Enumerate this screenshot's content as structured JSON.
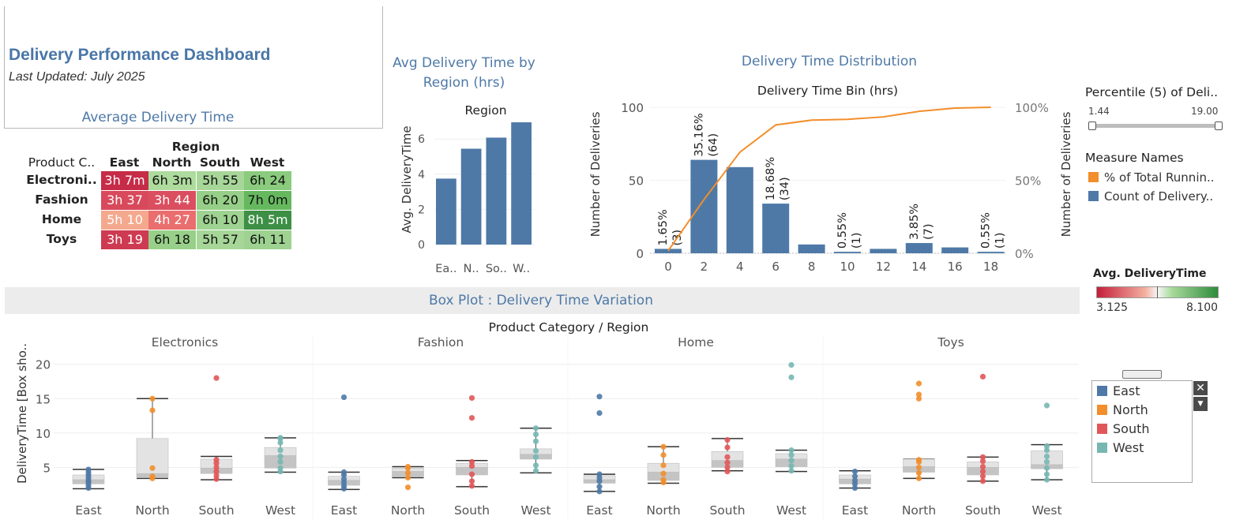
{
  "header": {
    "title": "Delivery Performance Dashboard",
    "subtitle": "Last Updated: July 2025"
  },
  "heatmap": {
    "title": "Average Delivery Time",
    "region_header": "Region",
    "row_header": "Product C..",
    "columns": [
      "East",
      "North",
      "South",
      "West"
    ],
    "rows": [
      {
        "label": "Electroni..",
        "values": [
          "3h 7m",
          "6h 3m",
          "5h 55",
          "6h 24"
        ],
        "colors": [
          "#c62c48",
          "#aedb9e",
          "#a7d699",
          "#8acb7d"
        ]
      },
      {
        "label": "Fashion",
        "values": [
          "3h 37",
          "3h 44",
          "6h 20",
          "7h 0m"
        ],
        "colors": [
          "#d9495c",
          "#da4e5f",
          "#96cf87",
          "#66b85f"
        ]
      },
      {
        "label": "Home",
        "values": [
          "5h 10",
          "4h 27",
          "6h 10",
          "8h 5m"
        ],
        "colors": [
          "#f4a98e",
          "#ea6e6e",
          "#9fd392",
          "#3d8f46"
        ]
      },
      {
        "label": "Toys",
        "values": [
          "3h 19",
          "6h 18",
          "5h 57",
          "6h 11"
        ],
        "colors": [
          "#ce3a52",
          "#98d089",
          "#a6d698",
          "#9dd291"
        ]
      }
    ]
  },
  "bar_title": "Avg Delivery Time by Region (hrs)",
  "dist_title": "Delivery Time Distribution",
  "box_title": "Box Plot : Delivery Time Variation",
  "chart_data": [
    {
      "type": "bar",
      "title": "Region",
      "ylabel": "Avg. DeliveryTime",
      "categories": [
        "Ea..",
        "N..",
        "So..",
        "W.."
      ],
      "values": [
        3.75,
        5.45,
        6.08,
        6.95
      ],
      "ylim": [
        0,
        7.4
      ],
      "yticks": [
        0,
        2,
        4,
        6
      ],
      "color": "#4e79a7"
    },
    {
      "type": "bar",
      "title": "Delivery Time Bin (hrs)",
      "ylabel": "Number of Deliveries",
      "ylabel_right": "Number of Deliveries",
      "x": [
        0,
        2,
        4,
        6,
        8,
        10,
        12,
        14,
        16,
        18
      ],
      "values": [
        3,
        64,
        59,
        34,
        6,
        1,
        3,
        7,
        4,
        1
      ],
      "labels": [
        "1.65%\n(3)",
        "35.16%\n(64)",
        "",
        "18.68%\n(34)",
        "",
        "0.55%\n(1)",
        "",
        "3.85%\n(7)",
        "",
        "0.55%\n(1)"
      ],
      "ylim": [
        0,
        100
      ],
      "yticks": [
        0,
        50,
        100
      ],
      "y2ticks": [
        "0%",
        "50%",
        "100%"
      ],
      "series": [
        {
          "name": "Count of Delivery..",
          "values": [
            3,
            64,
            59,
            34,
            6,
            1,
            3,
            7,
            4,
            1
          ]
        },
        {
          "name": "% of Total Runnin..",
          "values": [
            1.65,
            36.81,
            69.23,
            87.91,
            91.21,
            91.76,
            93.41,
            97.25,
            99.45,
            100
          ]
        }
      ],
      "colors": {
        "bar": "#4e79a7",
        "line": "#f28e2b"
      }
    },
    {
      "type": "scatter",
      "title": "Product Category  /  Region",
      "ylabel": "DeliveryTime [Box sho..",
      "ylim": [
        0,
        21
      ],
      "yticks": [
        5,
        10,
        15,
        20
      ],
      "categories": [
        "Electronics",
        "Fashion",
        "Home",
        "Toys"
      ],
      "regions": [
        "East",
        "North",
        "South",
        "West"
      ],
      "boxes": [
        {
          "cat": "Electronics",
          "region": "East",
          "min": 1.9,
          "q1": 2.6,
          "median": 3.2,
          "q3": 3.9,
          "max": 4.7,
          "points": [
            2.0,
            2.4,
            2.8,
            3.1,
            3.5,
            3.9,
            4.3,
            4.7
          ]
        },
        {
          "cat": "Electronics",
          "region": "North",
          "min": 3.4,
          "q1": 3.6,
          "median": 4.1,
          "q3": 9.2,
          "max": 15.0,
          "points": [
            3.4,
            3.7,
            4.9,
            13.3,
            15.0
          ]
        },
        {
          "cat": "Electronics",
          "region": "South",
          "min": 3.2,
          "q1": 4.1,
          "median": 4.9,
          "q3": 6.2,
          "max": 6.6,
          "points": [
            3.3,
            3.8,
            4.4,
            5.0,
            5.6,
            6.1,
            18.0
          ]
        },
        {
          "cat": "Electronics",
          "region": "West",
          "min": 4.3,
          "q1": 4.9,
          "median": 6.7,
          "q3": 7.9,
          "max": 9.3,
          "points": [
            4.4,
            4.9,
            5.8,
            6.6,
            7.5,
            8.6,
            9.2,
            9.3
          ]
        },
        {
          "cat": "Fashion",
          "region": "East",
          "min": 1.8,
          "q1": 2.4,
          "median": 3.1,
          "q3": 3.7,
          "max": 4.3,
          "points": [
            1.9,
            2.3,
            2.8,
            3.3,
            3.9,
            4.3,
            15.2
          ]
        },
        {
          "cat": "Fashion",
          "region": "North",
          "min": 3.5,
          "q1": 3.6,
          "median": 4.4,
          "q3": 4.9,
          "max": 5.1,
          "points": [
            2.1,
            3.5,
            4.2,
            4.9,
            5.1
          ]
        },
        {
          "cat": "Fashion",
          "region": "South",
          "min": 2.2,
          "q1": 3.9,
          "median": 5.0,
          "q3": 5.6,
          "max": 6.0,
          "points": [
            2.3,
            3.0,
            4.0,
            5.2,
            5.8,
            12.2,
            15.1
          ]
        },
        {
          "cat": "Fashion",
          "region": "West",
          "min": 4.2,
          "q1": 6.2,
          "median": 6.9,
          "q3": 7.7,
          "max": 10.7,
          "points": [
            4.5,
            5.3,
            6.5,
            7.4,
            8.8,
            9.8,
            10.7
          ]
        },
        {
          "cat": "Home",
          "region": "East",
          "min": 1.5,
          "q1": 2.7,
          "median": 3.2,
          "q3": 3.8,
          "max": 4.0,
          "points": [
            1.5,
            2.2,
            3.0,
            3.5,
            4.0,
            12.9,
            15.3
          ]
        },
        {
          "cat": "Home",
          "region": "North",
          "min": 2.7,
          "q1": 3.1,
          "median": 4.3,
          "q3": 5.6,
          "max": 8.0,
          "points": [
            2.8,
            3.2,
            4.1,
            5.3,
            6.8,
            8.0
          ]
        },
        {
          "cat": "Home",
          "region": "South",
          "min": 4.5,
          "q1": 5.0,
          "median": 6.0,
          "q3": 7.3,
          "max": 9.2,
          "points": [
            4.4,
            5.0,
            5.7,
            6.5,
            7.9,
            9.0
          ]
        },
        {
          "cat": "Home",
          "region": "West",
          "min": 4.4,
          "q1": 5.1,
          "median": 6.2,
          "q3": 7.0,
          "max": 7.5,
          "points": [
            4.5,
            5.2,
            6.0,
            6.8,
            7.5,
            18.1,
            19.9
          ]
        },
        {
          "cat": "Toys",
          "region": "East",
          "min": 2.0,
          "q1": 2.6,
          "median": 3.3,
          "q3": 3.9,
          "max": 4.5,
          "points": [
            2.0,
            2.6,
            3.1,
            3.7,
            4.4
          ]
        },
        {
          "cat": "Toys",
          "region": "North",
          "min": 3.4,
          "q1": 4.3,
          "median": 5.1,
          "q3": 6.2,
          "max": 6.2,
          "points": [
            3.4,
            4.2,
            5.0,
            5.8,
            6.1,
            15.0,
            15.6,
            17.2
          ]
        },
        {
          "cat": "Toys",
          "region": "South",
          "min": 3.0,
          "q1": 3.9,
          "median": 5.0,
          "q3": 5.8,
          "max": 6.5,
          "points": [
            3.0,
            3.7,
            4.4,
            5.1,
            5.9,
            6.5,
            18.2
          ]
        },
        {
          "cat": "Toys",
          "region": "West",
          "min": 3.2,
          "q1": 4.8,
          "median": 5.4,
          "q3": 7.4,
          "max": 8.3,
          "points": [
            3.2,
            4.0,
            4.9,
            5.8,
            6.6,
            7.5,
            8.1,
            14.0
          ]
        }
      ]
    }
  ],
  "sidebar": {
    "percentile_title": "Percentile (5) of Deli..",
    "slider_min": "1.44",
    "slider_max": "19.00",
    "measure_title": "Measure Names",
    "measure_items": [
      {
        "label": "% of Total Runnin..",
        "color": "#f28e2b"
      },
      {
        "label": "Count of Delivery..",
        "color": "#4e79a7"
      }
    ],
    "colorscale_title": "Avg. DeliveryTime",
    "colorscale_min": "3.125",
    "colorscale_max": "8.100",
    "region_legend": [
      {
        "label": "East",
        "color": "#4e79a7"
      },
      {
        "label": "North",
        "color": "#f28e2b"
      },
      {
        "label": "South",
        "color": "#e15759"
      },
      {
        "label": "West",
        "color": "#76b7b2"
      }
    ]
  }
}
